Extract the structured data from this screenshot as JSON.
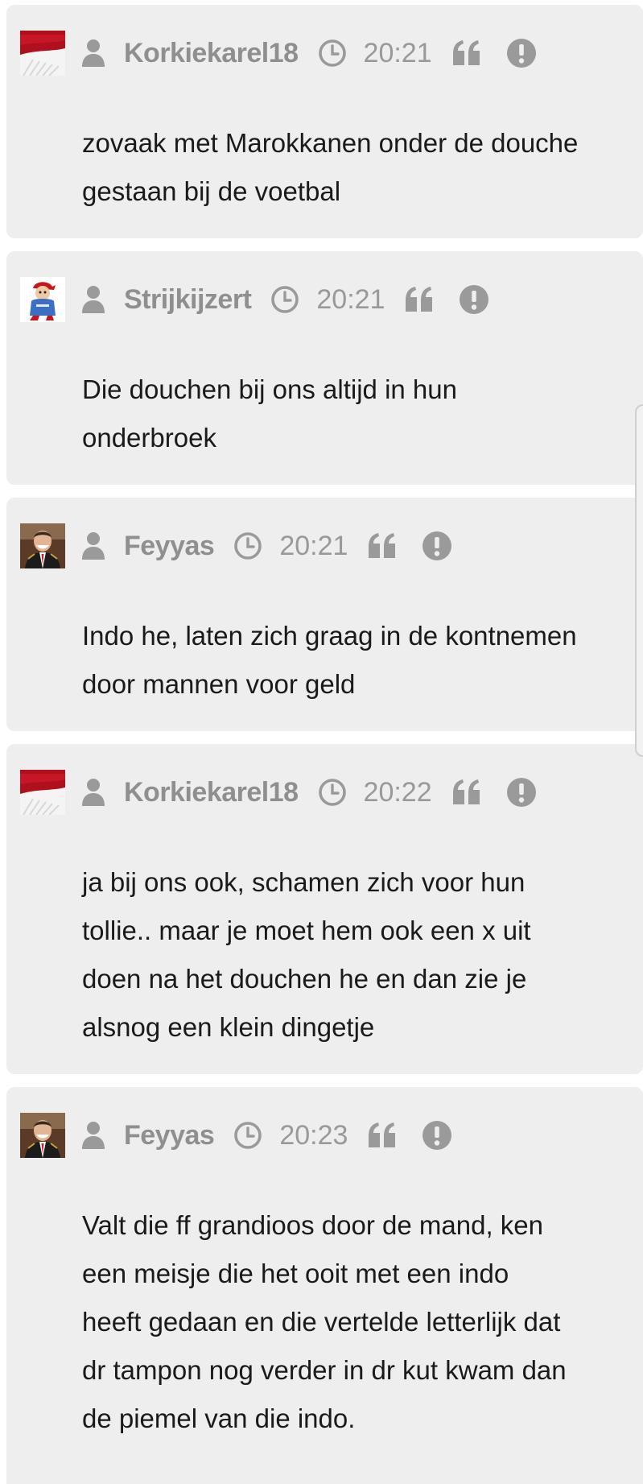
{
  "posts": [
    {
      "username": "Korkiekarel18",
      "time": "20:21",
      "avatar_icon": "flag-avatar",
      "text_lines": [
        "zovaak met Marokkanen onder de douche",
        "gestaan bij de voetbal"
      ]
    },
    {
      "username": "Strijkijzert",
      "time": "20:21",
      "avatar_icon": "cartoon-avatar",
      "text_lines": [
        "Die douchen bij ons altijd in hun",
        "onderbroek"
      ]
    },
    {
      "username": "Feyyas",
      "time": "20:21",
      "avatar_icon": "portrait-avatar",
      "text_lines": [
        "Indo he, laten zich graag in de kontnemen",
        "door mannen voor geld"
      ]
    },
    {
      "username": "Korkiekarel18",
      "time": "20:22",
      "avatar_icon": "flag-avatar",
      "text_lines": [
        "ja bij ons ook, schamen zich voor hun",
        "tollie.. maar je moet hem ook een x uit",
        "doen na het douchen he en dan zie je",
        "alsnog een klein dingetje"
      ]
    },
    {
      "username": "Feyyas",
      "time": "20:23",
      "avatar_icon": "portrait-avatar",
      "text_lines": [
        "Valt die ff grandioos door de mand, ken",
        "een meisje die het ooit met een indo",
        "heeft gedaan en die vertelde letterlijk dat",
        "dr tampon nog verder in dr kut kwam dan",
        "de piemel van die indo."
      ]
    }
  ],
  "colors": {
    "card_background": "#eeeeee",
    "meta_gray": "#999999",
    "text": "#1a1a1a"
  }
}
